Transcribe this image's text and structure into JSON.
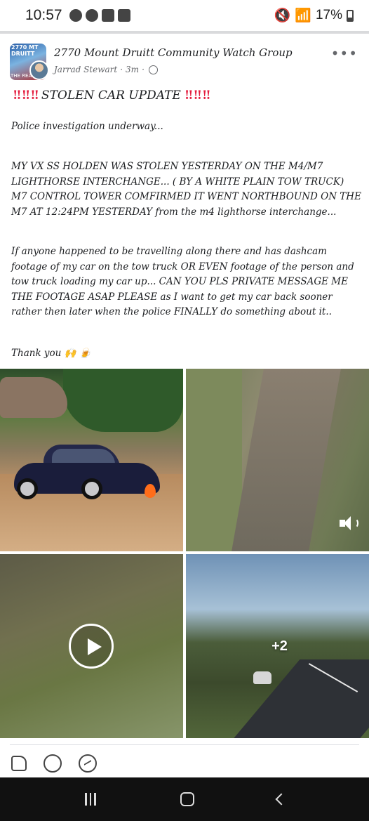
{
  "status_bar": {
    "time": "10:57",
    "battery": "17%",
    "icons": [
      "messenger-icon",
      "messenger-icon",
      "lock-icon",
      "gallery-icon",
      "mute-icon",
      "wifi-icon",
      "signal-icon",
      "battery-icon"
    ]
  },
  "post": {
    "group_name": "2770 Mount Druitt Community Watch Group",
    "author": "Jarrad Stewart",
    "time_ago": "3m",
    "separator": "·",
    "title_marks_left": "‼ ‼ ‼",
    "title": "STOLEN CAR UPDATE",
    "title_marks_right": "‼ ‼ ‼",
    "paragraphs": [
      "Police investigation underway...",
      "MY VX SS HOLDEN WAS STOLEN YESTERDAY ON THE M4/M7 LIGHTHORSE INTERCHANGE... ( BY A WHITE PLAIN TOW TRUCK) M7 CONTROL TOWER COMFIRMED IT WENT NORTHBOUND ON THE M7 AT 12:24PM YESTERDAY from the m4 lighthorse interchange...",
      "If anyone happened to be travelling along there and has dashcam footage of my car on the tow truck OR EVEN footage of the person and tow truck loading my car up... CAN YOU PLS PRIVATE MESSAGE ME THE FOOTAGE ASAP PLEASE as I want to get my car back sooner rather then later when the police FINALLY do something about it..",
      "Thank you 🙌 🍺"
    ],
    "more_photos_count": "+2",
    "group_avatar_text_top": "2770 MT DRUITT",
    "group_avatar_text_bottom": "THE REAL"
  },
  "actions": {
    "like_icon": "thumbs-up-icon",
    "comment_icon": "comment-icon",
    "share_icon": "messenger-share-icon"
  },
  "colors": {
    "accent_red": "#e41e3f",
    "text": "#1c1e21",
    "meta": "#65676b"
  }
}
